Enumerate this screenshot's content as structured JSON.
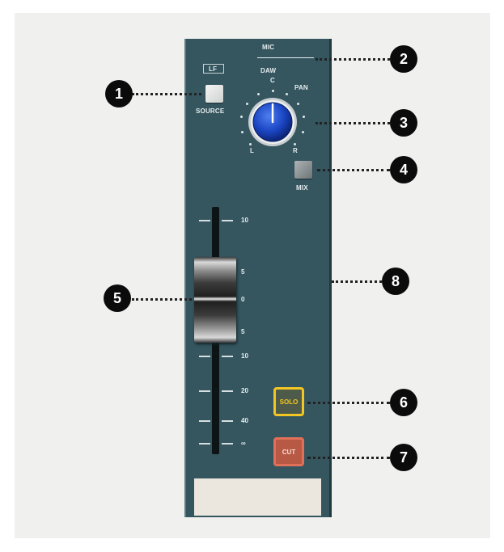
{
  "strip": {
    "mic": "MIC",
    "daw": "DAW",
    "lf": "LF",
    "source": "SOURCE",
    "pan": "PAN",
    "pan_c": "C",
    "pan_l": "L",
    "pan_r": "R",
    "mix": "MIX",
    "solo": "SOLO",
    "cut": "CUT"
  },
  "fader_scale": [
    "10",
    "5",
    "0",
    "5",
    "10",
    "20",
    "40",
    "∞"
  ],
  "callouts": [
    "1",
    "2",
    "3",
    "4",
    "5",
    "6",
    "7",
    "8"
  ],
  "colors": {
    "strip": "#35555f",
    "knob": "#1b46c4",
    "solo": "#f2c623",
    "cut": "#e07058"
  }
}
